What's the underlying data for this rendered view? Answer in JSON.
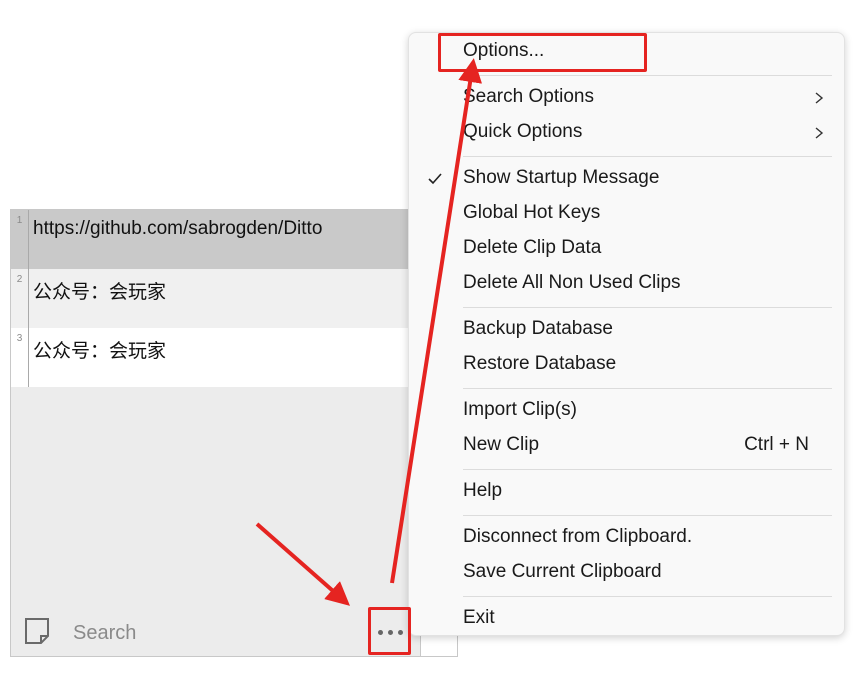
{
  "clips": [
    {
      "num": "1",
      "text": "https://github.com/sabrogden/Ditto"
    },
    {
      "num": "2",
      "text": "公众号：会玩家"
    },
    {
      "num": "3",
      "text": "公众号：会玩家"
    }
  ],
  "search": {
    "placeholder": "Search"
  },
  "menu": {
    "options": "Options...",
    "search_options": "Search Options",
    "quick_options": "Quick Options",
    "show_startup_message": "Show Startup Message",
    "global_hot_keys": "Global Hot Keys",
    "delete_clip_data": "Delete Clip Data",
    "delete_all_non_used_clips": "Delete All Non Used Clips",
    "backup_database": "Backup Database",
    "restore_database": "Restore Database",
    "import_clips": "Import Clip(s)",
    "new_clip": "New Clip",
    "new_clip_shortcut": "Ctrl + N",
    "help": "Help",
    "disconnect_clipboard": "Disconnect from Clipboard.",
    "save_current_clipboard": "Save Current Clipboard",
    "exit": "Exit"
  },
  "colors": {
    "annotation_red": "#e52421",
    "selected_row": "#c9c9c9",
    "menu_bg": "#f9f9f9"
  },
  "icons": {
    "search_bar_left": "note-icon",
    "more": "ellipsis-icon",
    "submenu": "chevron-right-icon",
    "checked": "checkmark-icon"
  }
}
